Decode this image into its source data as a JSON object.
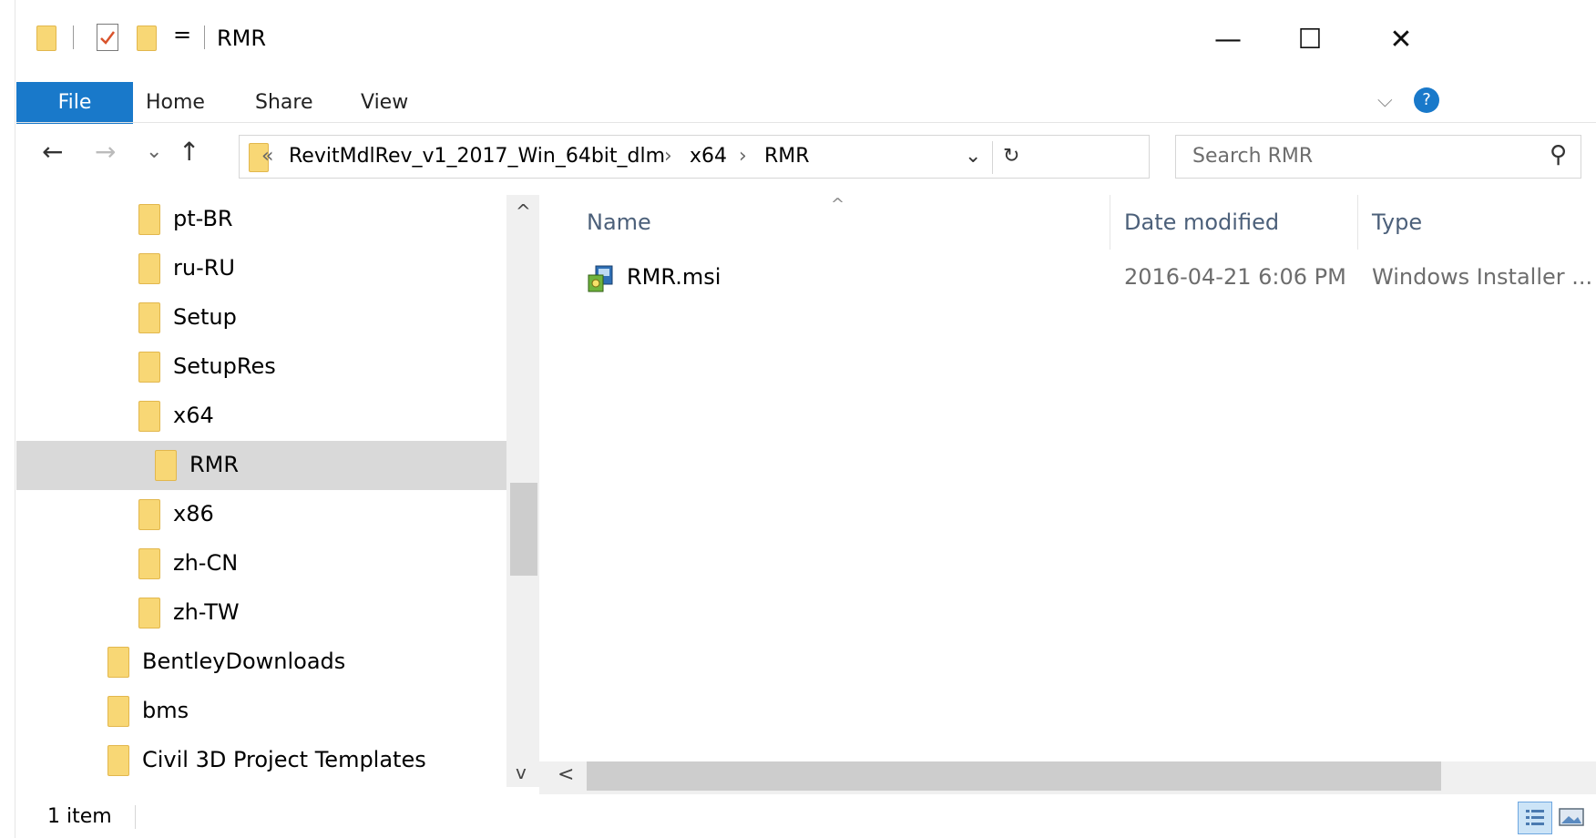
{
  "window": {
    "title": "RMR",
    "controls": {
      "minimize": "—",
      "maximize": "☐",
      "close": "✕"
    }
  },
  "quick_access": {
    "dropdown_glyph": "="
  },
  "ribbon": {
    "tabs": [
      "File",
      "Home",
      "Share",
      "View"
    ],
    "collapse_glyph": "⌵",
    "help_glyph": "?"
  },
  "nav": {
    "back": "←",
    "forward": "→",
    "recent": "⌄",
    "up": "↑",
    "path_overflow": "«",
    "breadcrumb": [
      "RevitMdlRev_v1_2017_Win_64bit_dlm",
      "x64",
      "RMR"
    ],
    "crumb_sep": "›",
    "history_dropdown": "⌄",
    "refresh": "↻",
    "search_placeholder": "Search RMR",
    "search_icon_glyph": "⚲"
  },
  "tree": {
    "scroll_up": "^",
    "scroll_down": "v",
    "items": [
      {
        "label": "pt-BR",
        "level": 2,
        "selected": false
      },
      {
        "label": "ru-RU",
        "level": 2,
        "selected": false
      },
      {
        "label": "Setup",
        "level": 2,
        "selected": false
      },
      {
        "label": "SetupRes",
        "level": 2,
        "selected": false
      },
      {
        "label": "x64",
        "level": 2,
        "selected": false
      },
      {
        "label": "RMR",
        "level": 3,
        "selected": true
      },
      {
        "label": "x86",
        "level": 2,
        "selected": false
      },
      {
        "label": "zh-CN",
        "level": 2,
        "selected": false
      },
      {
        "label": "zh-TW",
        "level": 2,
        "selected": false
      },
      {
        "label": "BentleyDownloads",
        "level": 1,
        "selected": false
      },
      {
        "label": "bms",
        "level": 1,
        "selected": false
      },
      {
        "label": "Civil 3D Project Templates",
        "level": 1,
        "selected": false
      }
    ]
  },
  "file_list": {
    "sort_glyph": "^",
    "columns": [
      "Name",
      "Date modified",
      "Type"
    ],
    "rows": [
      {
        "name": "RMR.msi",
        "date": "2016-04-21 6:06 PM",
        "type": "Windows Installer ..."
      }
    ],
    "scroll_left": "<"
  },
  "status": {
    "item_count": "1 item"
  },
  "colors": {
    "accent": "#1979ca",
    "folder": "#f8d775",
    "selected_row": "#d9d9d9",
    "column_header": "#4c607a"
  }
}
